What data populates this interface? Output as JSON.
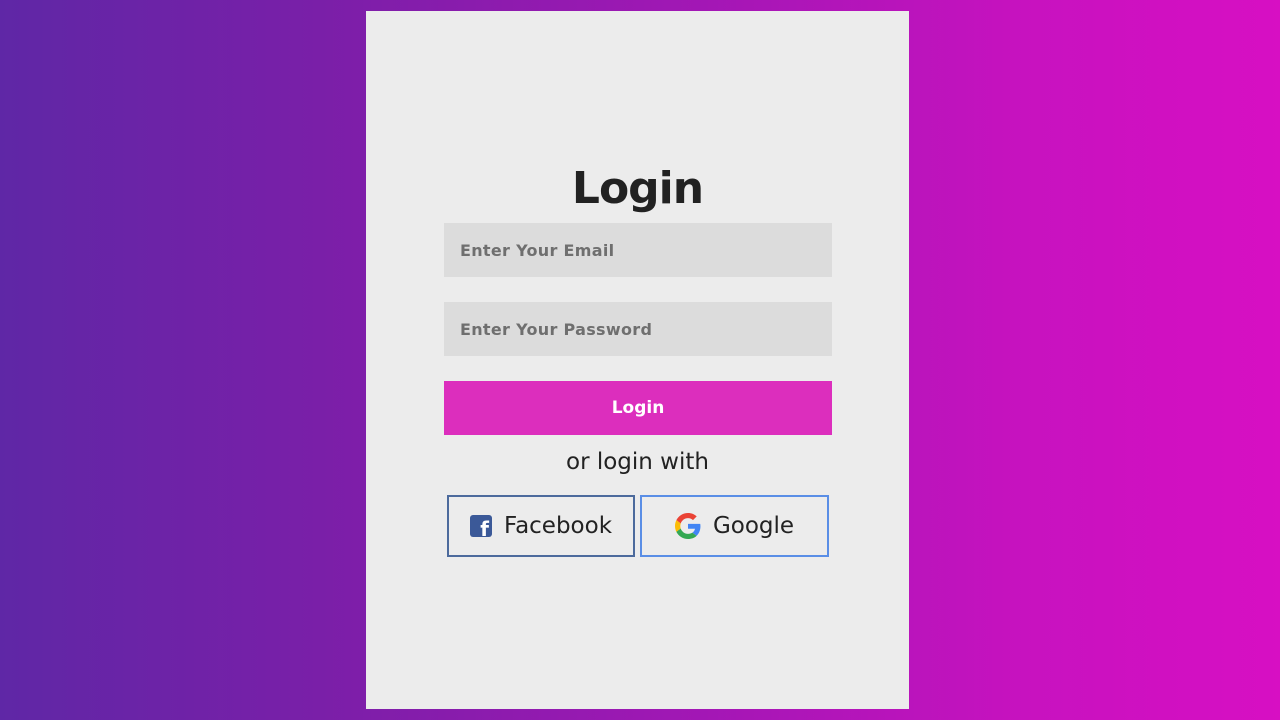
{
  "login_form": {
    "title": "Login",
    "email_placeholder": "Enter Your Email",
    "email_value": "",
    "password_placeholder": "Enter Your Password",
    "password_value": "",
    "submit_label": "Login",
    "divider_text": "or login with",
    "social": [
      {
        "label": "Facebook",
        "icon": "facebook-icon",
        "border_color": "#4c6a9c"
      },
      {
        "label": "Google",
        "icon": "google-icon",
        "border_color": "#5a8ee6"
      }
    ]
  },
  "colors": {
    "background_gradient_start": "#5f27a6",
    "background_gradient_end": "#d70fc3",
    "card_background": "#ececec",
    "input_background": "#dcdcdc",
    "primary_button": "#dc2ebd",
    "facebook_blue": "#3b5998",
    "google_blue": "#4285f4"
  }
}
